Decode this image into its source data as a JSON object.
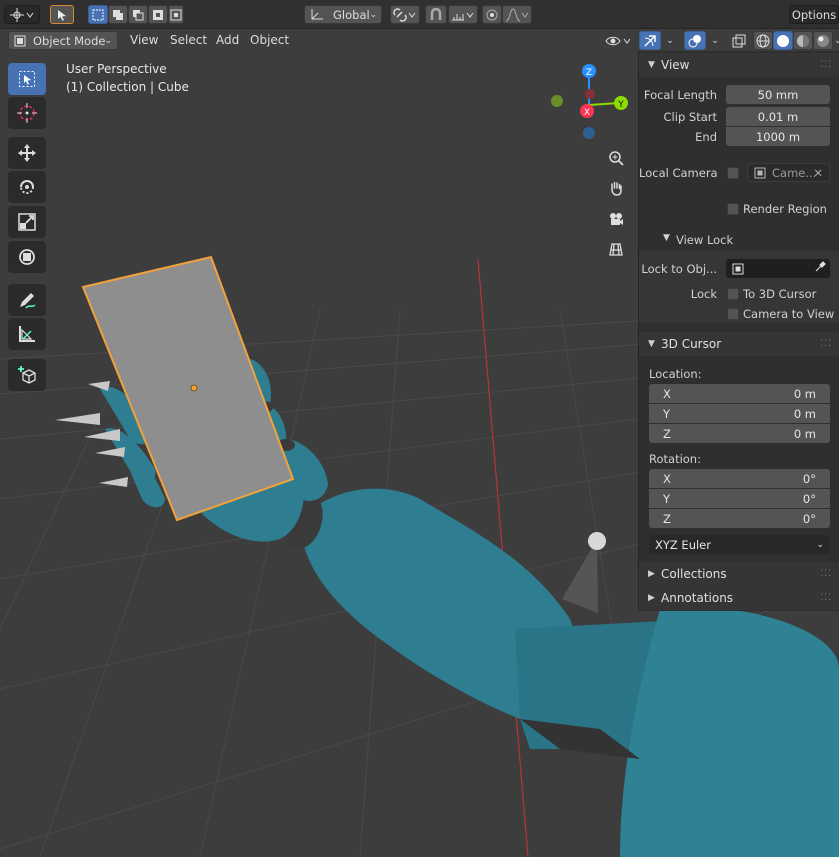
{
  "topbar": {
    "transform_orientation": "Global",
    "options_label": "Options"
  },
  "header": {
    "mode": "Object Mode",
    "menus": [
      "View",
      "Select",
      "Add",
      "Object"
    ]
  },
  "viewport": {
    "view_name": "User Perspective",
    "context": "(1) Collection | Cube",
    "axes": {
      "z": "Z",
      "y": "Y",
      "x": "X"
    }
  },
  "sidebar": {
    "view": {
      "title": "View",
      "focal_length_label": "Focal Length",
      "focal_length": "50 mm",
      "clip_start_label": "Clip Start",
      "clip_start": "0.01 m",
      "end_label": "End",
      "end": "1000 m",
      "local_camera_label": "Local Camera",
      "local_camera_value": "Came...",
      "render_region_label": "Render Region"
    },
    "view_lock": {
      "title": "View Lock",
      "lock_to_object_label": "Lock to Obj...",
      "lock_label": "Lock",
      "to_3d_cursor_label": "To 3D Cursor",
      "camera_to_view_label": "Camera to View"
    },
    "cursor": {
      "title": "3D Cursor",
      "location_label": "Location:",
      "location": [
        {
          "axis": "X",
          "value": "0 m"
        },
        {
          "axis": "Y",
          "value": "0 m"
        },
        {
          "axis": "Z",
          "value": "0 m"
        }
      ],
      "rotation_label": "Rotation:",
      "rotation": [
        {
          "axis": "X",
          "value": "0°"
        },
        {
          "axis": "Y",
          "value": "0°"
        },
        {
          "axis": "Z",
          "value": "0°"
        }
      ],
      "rotation_mode": "XYZ Euler"
    },
    "collections_title": "Collections",
    "annotations_title": "Annotations"
  },
  "colors": {
    "accent": "#4772b3",
    "selection": "#f2a23c",
    "model": "#2e7d91",
    "axis_x": "#ff3352",
    "axis_y": "#8bdc00",
    "axis_z": "#2890ff"
  }
}
